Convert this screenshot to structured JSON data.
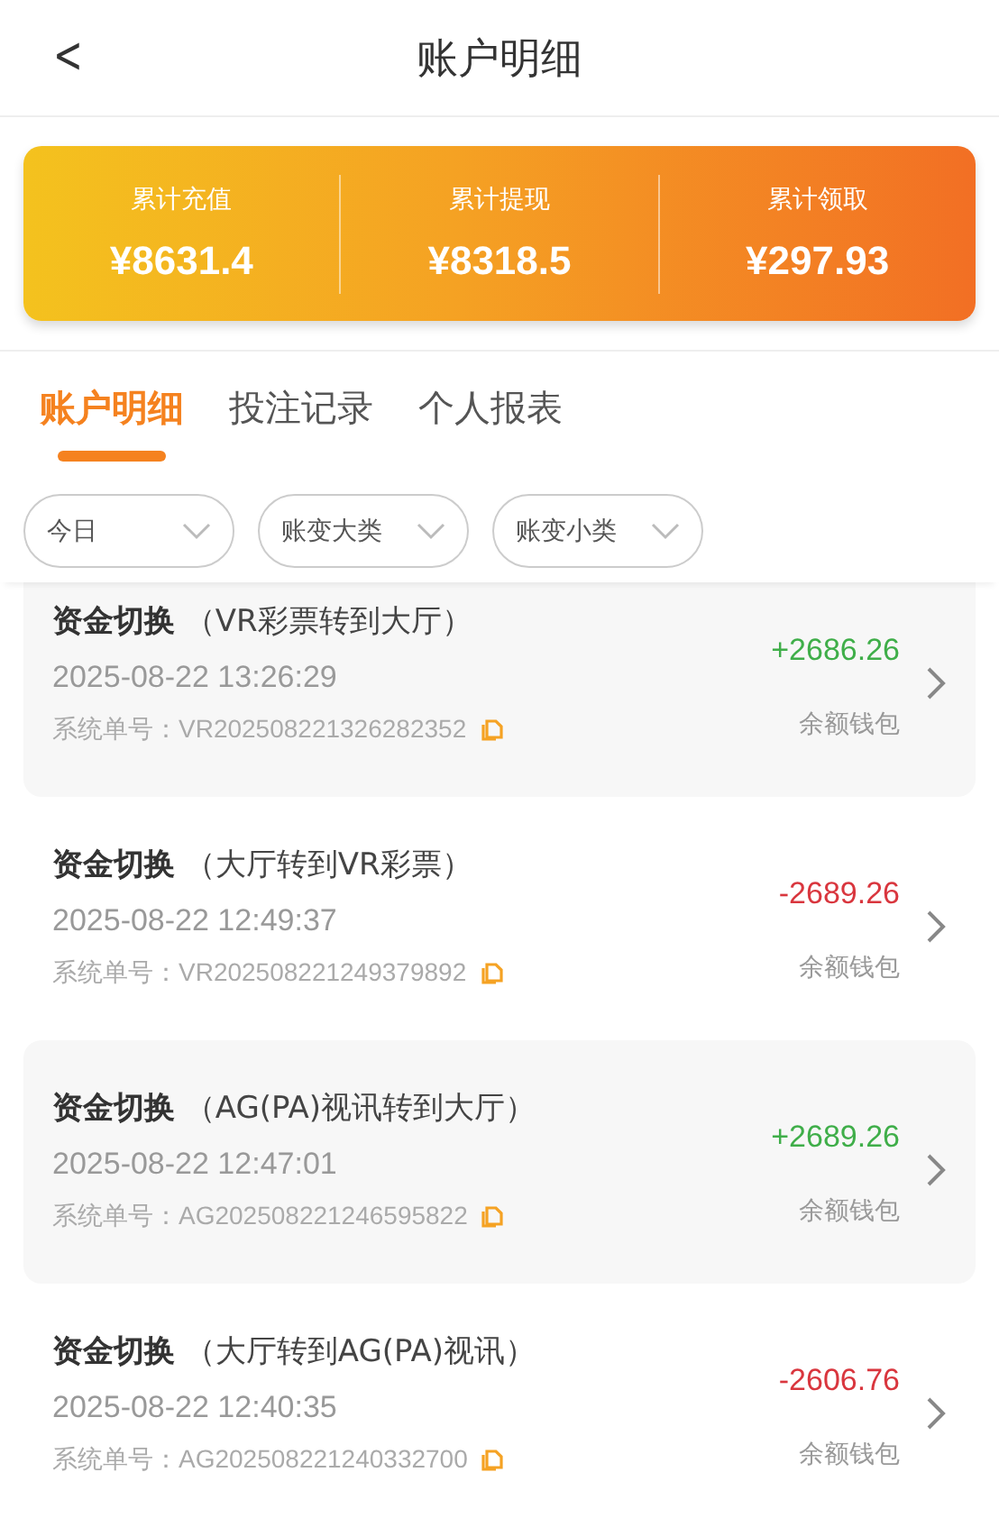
{
  "header": {
    "back_icon": "<",
    "title": "账户明细"
  },
  "summary": [
    {
      "label": "累计充值",
      "value": "¥8631.4"
    },
    {
      "label": "累计提现",
      "value": "¥8318.5"
    },
    {
      "label": "累计领取",
      "value": "¥297.93"
    }
  ],
  "tabs": [
    {
      "label": "账户明细",
      "selected": true
    },
    {
      "label": "投注记录",
      "selected": false
    },
    {
      "label": "个人报表",
      "selected": false
    }
  ],
  "filters": [
    {
      "label": "今日"
    },
    {
      "label": "账变大类"
    },
    {
      "label": "账变小类"
    }
  ],
  "records": [
    {
      "title": "**资金切换** （VR彩票转到大厅）",
      "time": "2025-08-22 13:26:29",
      "order_label": "系统单号：",
      "order_no": "VR202508221326282352",
      "amount": "+2686.26",
      "kind": "credit",
      "wallet": "余额钱包"
    },
    {
      "title": "**资金切换** （大厅转到VR彩票）",
      "time": "2025-08-22 12:49:37",
      "order_label": "系统单号：",
      "order_no": "VR202508221249379892",
      "amount": "-2689.26",
      "kind": "debit",
      "wallet": "余额钱包"
    },
    {
      "title": "**资金切换** （AG(PA)视讯转到大厅）",
      "time": "2025-08-22 12:47:01",
      "order_label": "系统单号：",
      "order_no": "AG202508221246595822",
      "amount": "+2689.26",
      "kind": "credit",
      "wallet": "余额钱包"
    },
    {
      "title": "**资金切换** （大厅转到AG(PA)视讯）",
      "time": "2025-08-22 12:40:35",
      "order_label": "系统单号：",
      "order_no": "AG202508221240332700",
      "amount": "-2606.76",
      "kind": "debit",
      "wallet": "余额钱包"
    }
  ]
}
